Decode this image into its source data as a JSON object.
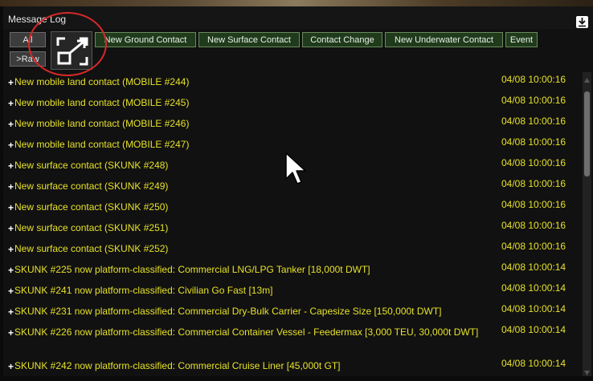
{
  "window": {
    "title": "Message Log"
  },
  "toolbar": {
    "all_label": "All",
    "raw_label": ">Raw",
    "filters": [
      {
        "label": "New Ground Contact"
      },
      {
        "label": "New Surface Contact"
      },
      {
        "label": "Contact Change"
      },
      {
        "label": "New Underwater Contact"
      },
      {
        "label": "Event"
      }
    ]
  },
  "icons": {
    "download": "download-icon",
    "expand": "expand-icon",
    "cursor": "mouse-pointer-icon"
  },
  "colors": {
    "message_text": "#e6e12a",
    "filter_bg": "#1f3b1c",
    "annotation": "#d82828"
  },
  "log": {
    "entries": [
      {
        "text": "New mobile land contact (MOBILE #244)",
        "time": "04/08 10:00:16"
      },
      {
        "text": "New mobile land contact (MOBILE #245)",
        "time": "04/08 10:00:16"
      },
      {
        "text": "New mobile land contact (MOBILE #246)",
        "time": "04/08 10:00:16"
      },
      {
        "text": "New mobile land contact (MOBILE #247)",
        "time": "04/08 10:00:16"
      },
      {
        "text": "New surface contact (SKUNK #248)",
        "time": "04/08 10:00:16"
      },
      {
        "text": "New surface contact (SKUNK #249)",
        "time": "04/08 10:00:16"
      },
      {
        "text": "New surface contact (SKUNK #250)",
        "time": "04/08 10:00:16"
      },
      {
        "text": "New surface contact (SKUNK #251)",
        "time": "04/08 10:00:16"
      },
      {
        "text": "New surface contact (SKUNK #252)",
        "time": "04/08 10:00:16"
      },
      {
        "text": "SKUNK #225 now platform-classified: Commercial LNG/LPG Tanker [18,000t DWT]",
        "time": "04/08 10:00:14"
      },
      {
        "text": "SKUNK #241 now platform-classified: Civilian Go Fast [13m]",
        "time": "04/08 10:00:14"
      },
      {
        "text": "SKUNK #231 now platform-classified: Commercial Dry-Bulk Carrier - Capesize Size [150,000t DWT]",
        "time": "04/08 10:00:14"
      },
      {
        "text": "SKUNK #226 now platform-classified: Commercial Container Vessel - Feedermax [3,000 TEU, 30,000t DWT]",
        "time": "04/08 10:00:14"
      },
      {
        "text": "SKUNK #242 now platform-classified: Commercial Cruise Liner [45,000t GT]",
        "time": "04/08 10:00:14"
      }
    ]
  }
}
